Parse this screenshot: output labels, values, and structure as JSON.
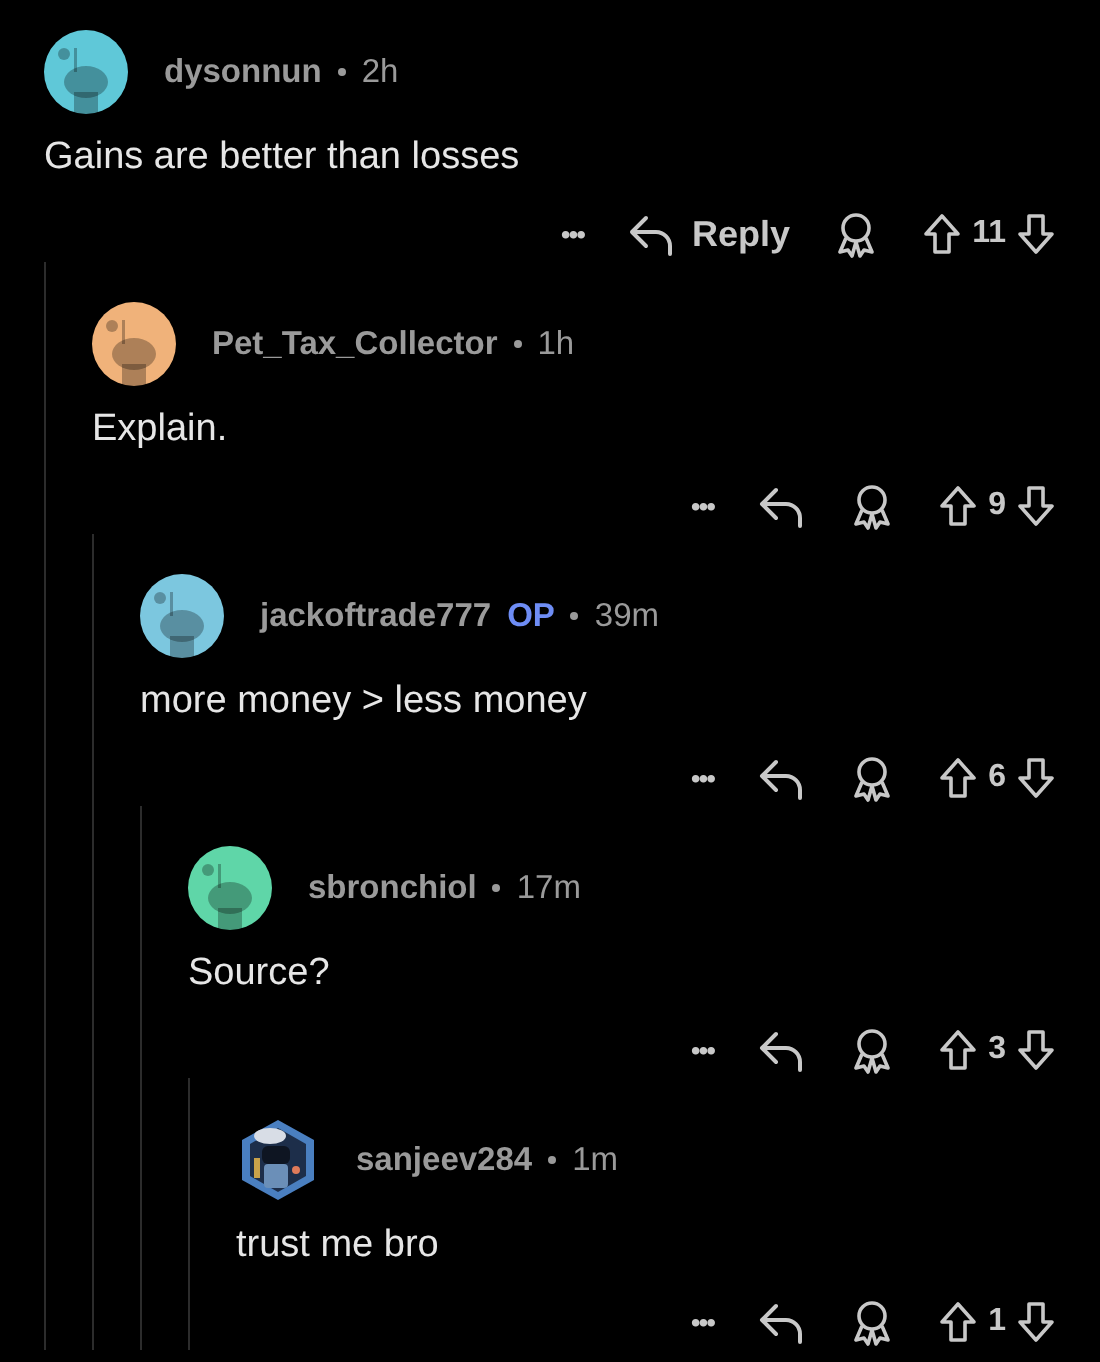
{
  "comment": {
    "author": "dysonnun",
    "op": false,
    "time": "2h",
    "avatar": {
      "kind": "snoo",
      "color": "#5fc8d8"
    },
    "body": "Gains are better than losses",
    "reply_label": "Reply",
    "more": "•••",
    "score": "11",
    "children": [
      {
        "author": "Pet_Tax_Collector",
        "op": false,
        "time": "1h",
        "avatar": {
          "kind": "snoo",
          "color": "#f0b27a"
        },
        "body": "Explain.",
        "more": "•••",
        "score": "9",
        "children": [
          {
            "author": "jackoftrade777",
            "op": true,
            "op_label": "OP",
            "time": "39m",
            "avatar": {
              "kind": "snoo",
              "color": "#7cc7df"
            },
            "body": "more money > less money",
            "more": "•••",
            "score": "6",
            "children": [
              {
                "author": "sbronchiol",
                "op": false,
                "time": "17m",
                "avatar": {
                  "kind": "snoo",
                  "color": "#5fd6a8"
                },
                "body": "Source?",
                "more": "•••",
                "score": "3",
                "children": [
                  {
                    "author": "sanjeev284",
                    "op": false,
                    "time": "1m",
                    "body": "trust me bro",
                    "more": "•••",
                    "score": "1"
                  }
                ]
              }
            ]
          }
        ]
      }
    ]
  }
}
